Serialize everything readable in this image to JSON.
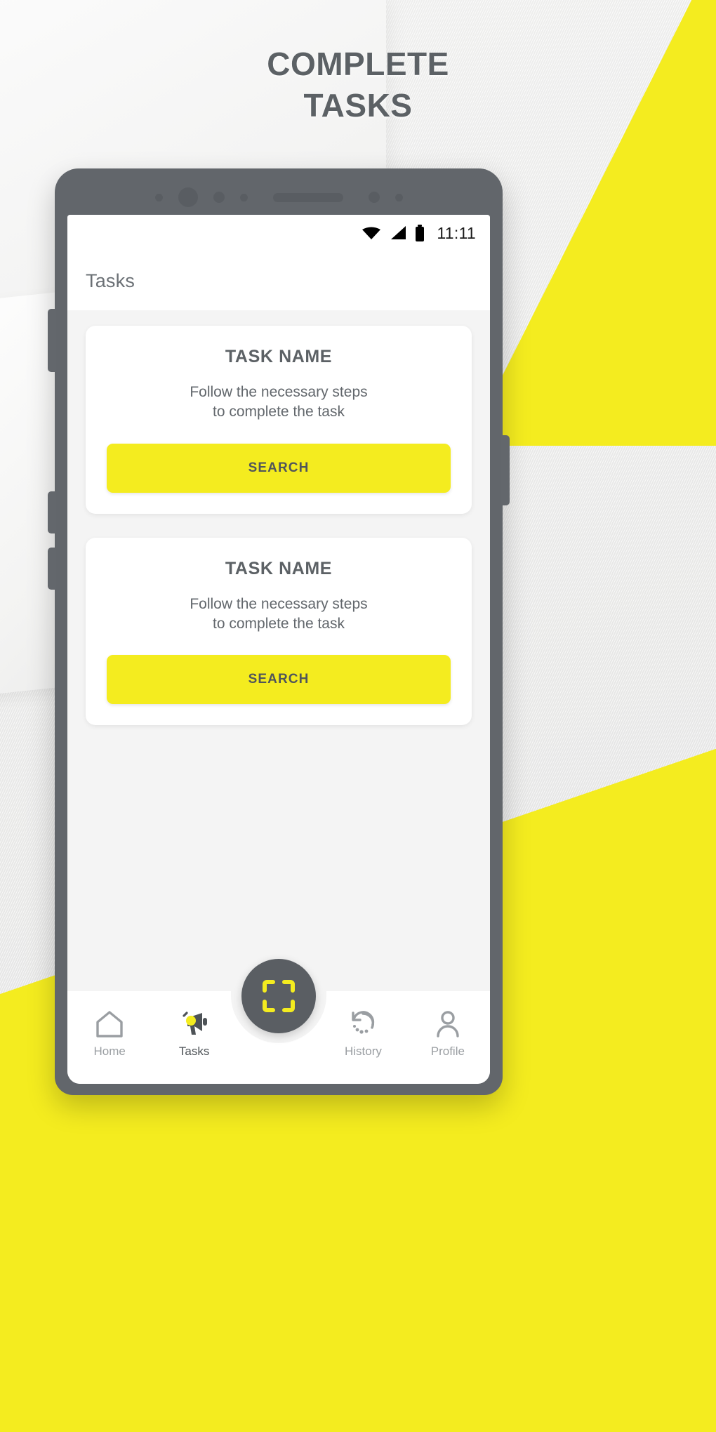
{
  "poster": {
    "title_line1": "COMPLETE",
    "title_line2": "TASKS",
    "accent_color": "#f4ec1f",
    "title_color": "#5c6165",
    "background_color": "#f2f2f1"
  },
  "phone": {
    "bezel_color": "#62666b",
    "screen_background": "#f4f4f4"
  },
  "statusbar": {
    "time": "11:11",
    "wifi_icon": "wifi-icon",
    "signal_icon": "signal-icon",
    "battery_icon": "battery-icon"
  },
  "appbar": {
    "title": "Tasks"
  },
  "cards": [
    {
      "title": "TASK NAME",
      "description": "Follow the necessary steps\nto complete the task",
      "button_label": "SEARCH"
    },
    {
      "title": "TASK NAME",
      "description": "Follow the necessary steps\nto complete the task",
      "button_label": "SEARCH"
    }
  ],
  "bottomnav": {
    "items": [
      {
        "label": "Home",
        "icon": "home-icon",
        "active": false
      },
      {
        "label": "Tasks",
        "icon": "megaphone-icon",
        "active": true
      },
      {
        "label": "History",
        "icon": "history-icon",
        "active": false
      },
      {
        "label": "Profile",
        "icon": "person-icon",
        "active": false
      }
    ],
    "fab": {
      "icon": "scan-icon",
      "color": "#5a5e63",
      "accent": "#f4ec1f"
    }
  }
}
